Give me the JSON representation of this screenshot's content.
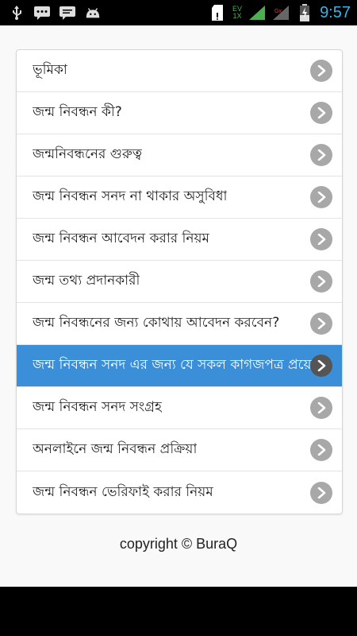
{
  "status_bar": {
    "time": "9:57",
    "network_top": "EV",
    "network_bottom": "1X",
    "icons": [
      "usb-icon",
      "chat-bubble-icon",
      "chat-bubble-icon",
      "android-icon",
      "sd-card-icon",
      "signal-icon",
      "signal-icon",
      "battery-icon"
    ],
    "accent_color": "#33b5e5"
  },
  "menu": {
    "items": [
      {
        "label": "ভূমিকা"
      },
      {
        "label": "জন্ম নিবন্ধন কী?"
      },
      {
        "label": "জন্মনিবন্ধনের গুরুত্ব"
      },
      {
        "label": "জন্ম নিবন্ধন সনদ না থাকার অসুবিধা"
      },
      {
        "label": "জন্ম নিবন্ধন আবেদন করার নিয়ম"
      },
      {
        "label": "জন্ম তথ্য প্রদানকারী"
      },
      {
        "label": "জন্ম নিবন্ধনের জন্য কোথায় আবেদন করবেন?"
      },
      {
        "label": "জন্ম নিবন্ধন সনদ এর জন্য যে সকল কাগজপত্র প্রয়ো",
        "active": true
      },
      {
        "label": "জন্ম নিবন্ধন সনদ সংগ্রহ"
      },
      {
        "label": "অনলাইনে জন্ম নিবন্ধন প্রক্রিয়া"
      },
      {
        "label": "জন্ম নিবন্ধন ভেরিফাই করার নিয়ম"
      }
    ],
    "active_color": "#3b8fd9",
    "chevron_icon": "chevron-right-icon"
  },
  "footer": {
    "copyright": "copyright © BuraQ"
  }
}
